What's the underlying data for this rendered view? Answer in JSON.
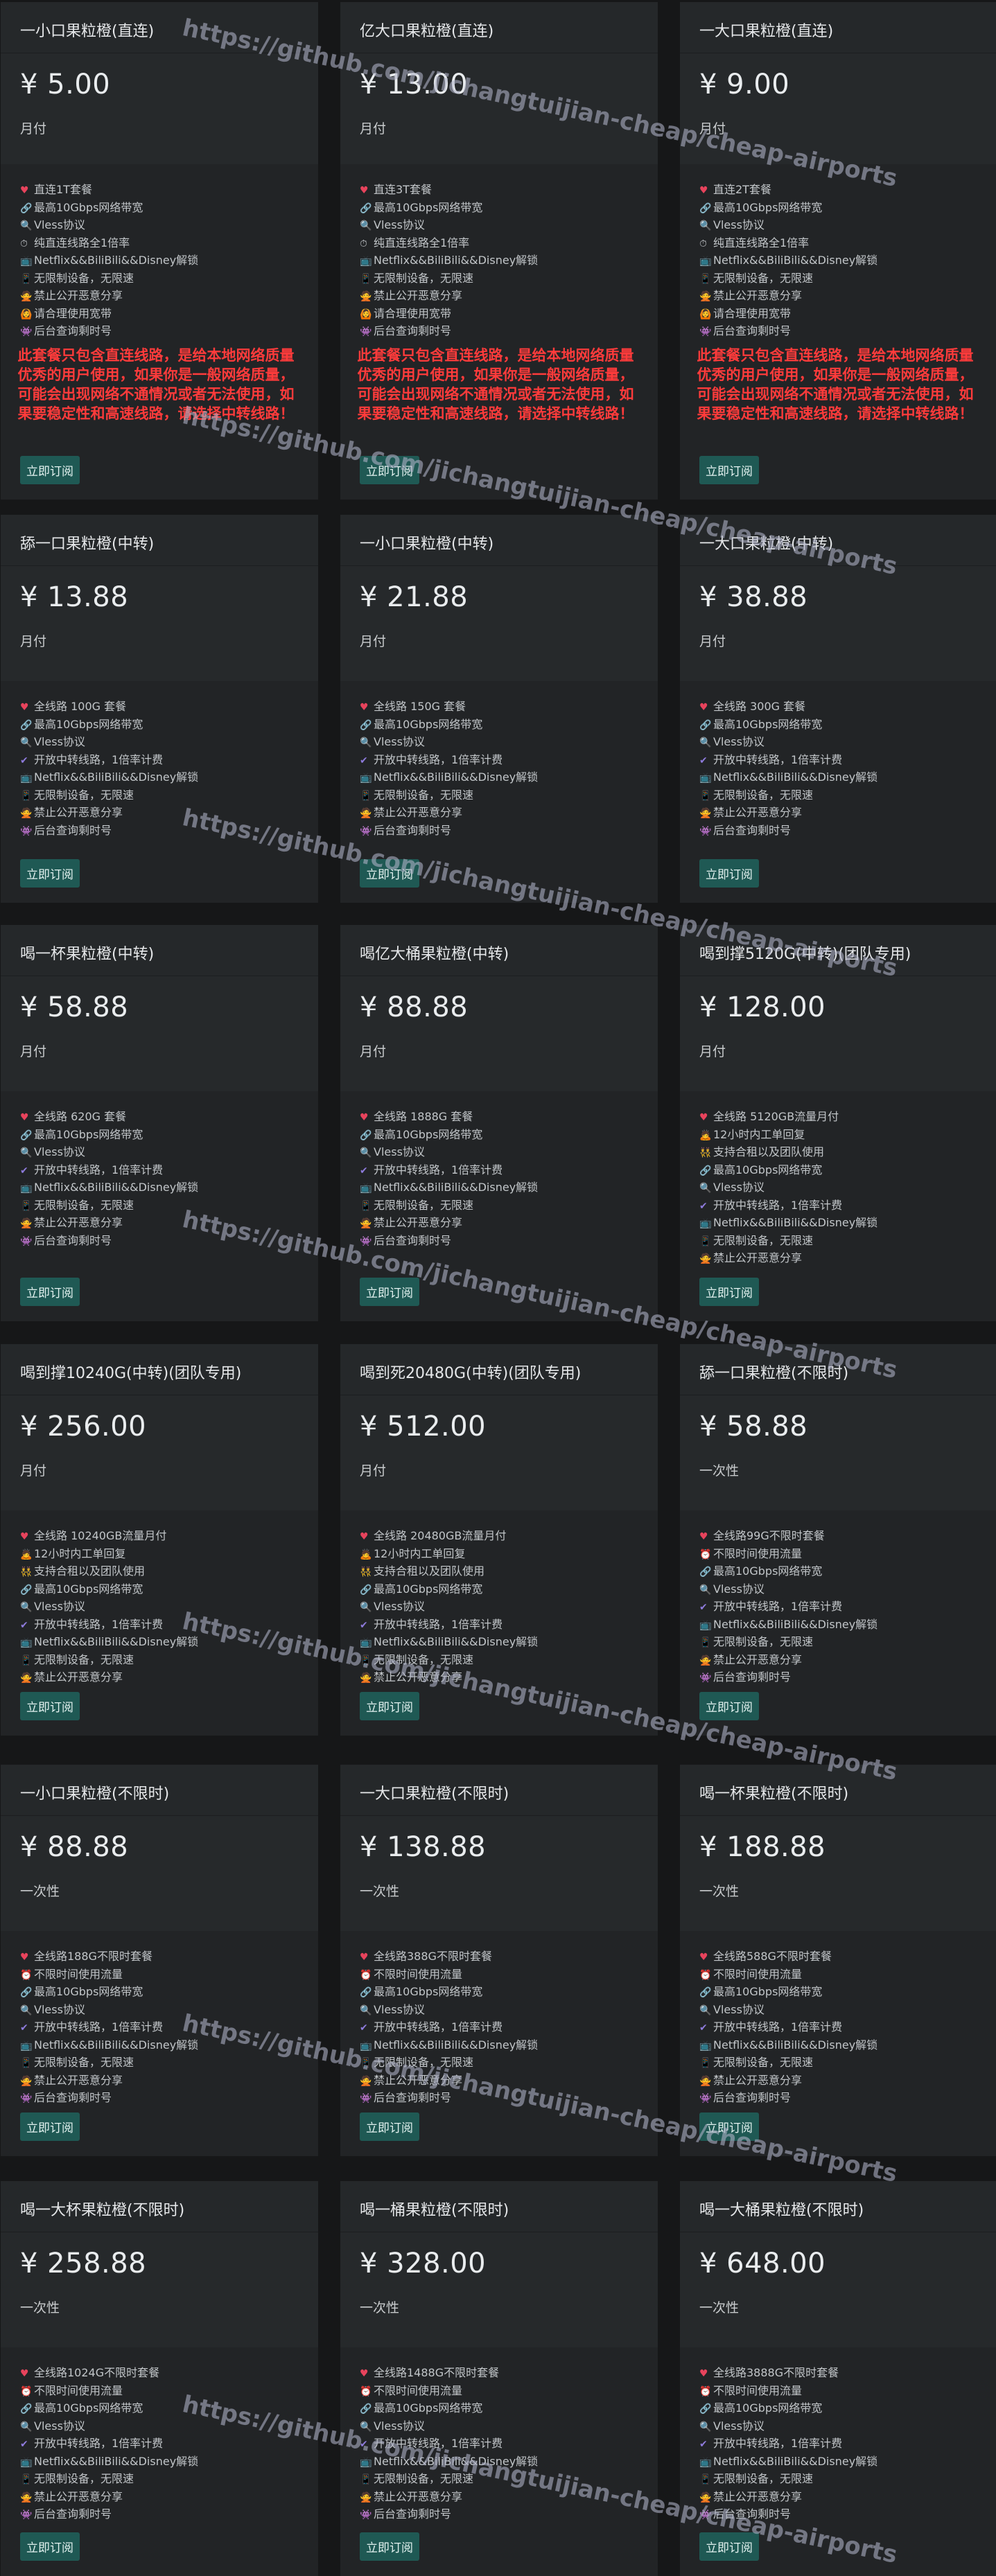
{
  "button_label": "立即订阅",
  "watermark": "https://github.com/jichangtuijian-cheap/cheap-airports",
  "warning": "此套餐只包含直连线路，是给本地网络质量优秀的用户使用，如果你是一般网络质量，可能会出现网络不通情况或者无法使用，如果要稳定性和高速线路，请选择中转线路！",
  "plans": [
    {
      "title": "一小口果粒橙(直连)",
      "price": "¥ 5.00",
      "period": "月付",
      "warning": true,
      "features": [
        [
          "heart",
          "直连1T套餐"
        ],
        [
          "link",
          "最高10Gbps网络带宽"
        ],
        [
          "search",
          "Vless协议"
        ],
        [
          "clock",
          "纯直连线路全1倍率"
        ],
        [
          "tv",
          "Netflix&&BiliBili&&Disney解锁"
        ],
        [
          "phone",
          "无限制设备，无限速"
        ],
        [
          "no",
          "禁止公开恶意分享"
        ],
        [
          "no2",
          "请合理使用宽带"
        ],
        [
          "admin",
          "后台查询剩时号"
        ]
      ]
    },
    {
      "title": "亿大口果粒橙(直连)",
      "price": "¥ 13.00",
      "period": "月付",
      "warning": true,
      "features": [
        [
          "heart",
          "直连3T套餐"
        ],
        [
          "link",
          "最高10Gbps网络带宽"
        ],
        [
          "search",
          "Vless协议"
        ],
        [
          "clock",
          "纯直连线路全1倍率"
        ],
        [
          "tv",
          "Netflix&&BiliBili&&Disney解锁"
        ],
        [
          "phone",
          "无限制设备，无限速"
        ],
        [
          "no",
          "禁止公开恶意分享"
        ],
        [
          "no2",
          "请合理使用宽带"
        ],
        [
          "admin",
          "后台查询剩时号"
        ]
      ]
    },
    {
      "title": "一大口果粒橙(直连)",
      "price": "¥ 9.00",
      "period": "月付",
      "warning": true,
      "features": [
        [
          "heart",
          "直连2T套餐"
        ],
        [
          "link",
          "最高10Gbps网络带宽"
        ],
        [
          "search",
          "Vless协议"
        ],
        [
          "clock",
          "纯直连线路全1倍率"
        ],
        [
          "tv",
          "Netflix&&BiliBili&&Disney解锁"
        ],
        [
          "phone",
          "无限制设备，无限速"
        ],
        [
          "no",
          "禁止公开恶意分享"
        ],
        [
          "no2",
          "请合理使用宽带"
        ],
        [
          "admin",
          "后台查询剩时号"
        ]
      ]
    },
    {
      "title": "舔一口果粒橙(中转)",
      "price": "¥ 13.88",
      "period": "月付",
      "warning": false,
      "features": [
        [
          "heart",
          "全线路 100G 套餐"
        ],
        [
          "link",
          "最高10Gbps网络带宽"
        ],
        [
          "search",
          "Vless协议"
        ],
        [
          "check",
          "开放中转线路，1倍率计费"
        ],
        [
          "tv",
          "Netflix&&BiliBili&&Disney解锁"
        ],
        [
          "phone",
          "无限制设备，无限速"
        ],
        [
          "no",
          "禁止公开恶意分享"
        ],
        [
          "admin",
          "后台查询剩时号"
        ]
      ]
    },
    {
      "title": "一小口果粒橙(中转)",
      "price": "¥ 21.88",
      "period": "月付",
      "warning": false,
      "features": [
        [
          "heart",
          "全线路 150G 套餐"
        ],
        [
          "link",
          "最高10Gbps网络带宽"
        ],
        [
          "search",
          "Vless协议"
        ],
        [
          "check",
          "开放中转线路，1倍率计费"
        ],
        [
          "tv",
          "Netflix&&BiliBili&&Disney解锁"
        ],
        [
          "phone",
          "无限制设备，无限速"
        ],
        [
          "no",
          "禁止公开恶意分享"
        ],
        [
          "admin",
          "后台查询剩时号"
        ]
      ]
    },
    {
      "title": "一大口果粒橙(中转)",
      "price": "¥ 38.88",
      "period": "月付",
      "warning": false,
      "features": [
        [
          "heart",
          "全线路 300G 套餐"
        ],
        [
          "link",
          "最高10Gbps网络带宽"
        ],
        [
          "search",
          "Vless协议"
        ],
        [
          "check",
          "开放中转线路，1倍率计费"
        ],
        [
          "tv",
          "Netflix&&BiliBili&&Disney解锁"
        ],
        [
          "phone",
          "无限制设备，无限速"
        ],
        [
          "no",
          "禁止公开恶意分享"
        ],
        [
          "admin",
          "后台查询剩时号"
        ]
      ]
    },
    {
      "title": "喝一杯果粒橙(中转)",
      "price": "¥ 58.88",
      "period": "月付",
      "warning": false,
      "features": [
        [
          "heart",
          "全线路 620G 套餐"
        ],
        [
          "link",
          "最高10Gbps网络带宽"
        ],
        [
          "search",
          "Vless协议"
        ],
        [
          "check",
          "开放中转线路，1倍率计费"
        ],
        [
          "tv",
          "Netflix&&BiliBili&&Disney解锁"
        ],
        [
          "phone",
          "无限制设备，无限速"
        ],
        [
          "no",
          "禁止公开恶意分享"
        ],
        [
          "admin",
          "后台查询剩时号"
        ]
      ]
    },
    {
      "title": "喝亿大桶果粒橙(中转)",
      "price": "¥ 88.88",
      "period": "月付",
      "warning": false,
      "features": [
        [
          "heart",
          "全线路 1888G 套餐"
        ],
        [
          "link",
          "最高10Gbps网络带宽"
        ],
        [
          "search",
          "Vless协议"
        ],
        [
          "check",
          "开放中转线路，1倍率计费"
        ],
        [
          "tv",
          "Netflix&&BiliBili&&Disney解锁"
        ],
        [
          "phone",
          "无限制设备，无限速"
        ],
        [
          "no",
          "禁止公开恶意分享"
        ],
        [
          "admin",
          "后台查询剩时号"
        ]
      ]
    },
    {
      "title": "喝到撑5120G(中转)(团队专用)",
      "price": "¥ 128.00",
      "period": "月付",
      "warning": false,
      "features": [
        [
          "heart",
          "全线路 5120GB流量月付"
        ],
        [
          "person",
          "12小时内工单回复"
        ],
        [
          "team",
          "支持合租以及团队使用"
        ],
        [
          "link",
          "最高10Gbps网络带宽"
        ],
        [
          "search",
          "Vless协议"
        ],
        [
          "check",
          "开放中转线路，1倍率计费"
        ],
        [
          "tv",
          "Netflix&&BiliBili&&Disney解锁"
        ],
        [
          "phone",
          "无限制设备，无限速"
        ],
        [
          "no",
          "禁止公开恶意分享"
        ]
      ]
    },
    {
      "title": "喝到撑10240G(中转)(团队专用)",
      "price": "¥ 256.00",
      "period": "月付",
      "warning": false,
      "features": [
        [
          "heart",
          "全线路 10240GB流量月付"
        ],
        [
          "person",
          "12小时内工单回复"
        ],
        [
          "team",
          "支持合租以及团队使用"
        ],
        [
          "link",
          "最高10Gbps网络带宽"
        ],
        [
          "search",
          "Vless协议"
        ],
        [
          "check",
          "开放中转线路，1倍率计费"
        ],
        [
          "tv",
          "Netflix&&BiliBili&&Disney解锁"
        ],
        [
          "phone",
          "无限制设备，无限速"
        ],
        [
          "no",
          "禁止公开恶意分享"
        ]
      ]
    },
    {
      "title": "喝到死20480G(中转)(团队专用)",
      "price": "¥ 512.00",
      "period": "月付",
      "warning": false,
      "features": [
        [
          "heart",
          "全线路 20480GB流量月付"
        ],
        [
          "person",
          "12小时内工单回复"
        ],
        [
          "team",
          "支持合租以及团队使用"
        ],
        [
          "link",
          "最高10Gbps网络带宽"
        ],
        [
          "search",
          "Vless协议"
        ],
        [
          "check",
          "开放中转线路，1倍率计费"
        ],
        [
          "tv",
          "Netflix&&BiliBili&&Disney解锁"
        ],
        [
          "phone",
          "无限制设备，无限速"
        ],
        [
          "no",
          "禁止公开恶意分享"
        ]
      ]
    },
    {
      "title": "舔一口果粒橙(不限时)",
      "price": "¥ 58.88",
      "period": "一次性",
      "warning": false,
      "features": [
        [
          "heart",
          "全线路99G不限时套餐"
        ],
        [
          "clock2",
          "不限时间使用流量"
        ],
        [
          "link",
          "最高10Gbps网络带宽"
        ],
        [
          "search",
          "Vless协议"
        ],
        [
          "check",
          "开放中转线路，1倍率计费"
        ],
        [
          "tv",
          "Netflix&&BiliBili&&Disney解锁"
        ],
        [
          "phone",
          "无限制设备，无限速"
        ],
        [
          "no",
          "禁止公开恶意分享"
        ],
        [
          "admin",
          "后台查询剩时号"
        ]
      ]
    },
    {
      "title": "一小口果粒橙(不限时)",
      "price": "¥ 88.88",
      "period": "一次性",
      "warning": false,
      "features": [
        [
          "heart",
          "全线路188G不限时套餐"
        ],
        [
          "clock2",
          "不限时间使用流量"
        ],
        [
          "link",
          "最高10Gbps网络带宽"
        ],
        [
          "search",
          "Vless协议"
        ],
        [
          "check",
          "开放中转线路，1倍率计费"
        ],
        [
          "tv",
          "Netflix&&BiliBili&&Disney解锁"
        ],
        [
          "phone",
          "无限制设备，无限速"
        ],
        [
          "no",
          "禁止公开恶意分享"
        ],
        [
          "admin",
          "后台查询剩时号"
        ]
      ]
    },
    {
      "title": "一大口果粒橙(不限时)",
      "price": "¥ 138.88",
      "period": "一次性",
      "warning": false,
      "features": [
        [
          "heart",
          "全线路388G不限时套餐"
        ],
        [
          "clock2",
          "不限时间使用流量"
        ],
        [
          "link",
          "最高10Gbps网络带宽"
        ],
        [
          "search",
          "Vless协议"
        ],
        [
          "check",
          "开放中转线路，1倍率计费"
        ],
        [
          "tv",
          "Netflix&&BiliBili&&Disney解锁"
        ],
        [
          "phone",
          "无限制设备，无限速"
        ],
        [
          "no",
          "禁止公开恶意分享"
        ],
        [
          "admin",
          "后台查询剩时号"
        ]
      ]
    },
    {
      "title": "喝一杯果粒橙(不限时)",
      "price": "¥ 188.88",
      "period": "一次性",
      "warning": false,
      "features": [
        [
          "heart",
          "全线路588G不限时套餐"
        ],
        [
          "clock2",
          "不限时间使用流量"
        ],
        [
          "link",
          "最高10Gbps网络带宽"
        ],
        [
          "search",
          "Vless协议"
        ],
        [
          "check",
          "开放中转线路，1倍率计费"
        ],
        [
          "tv",
          "Netflix&&BiliBili&&Disney解锁"
        ],
        [
          "phone",
          "无限制设备，无限速"
        ],
        [
          "no",
          "禁止公开恶意分享"
        ],
        [
          "admin",
          "后台查询剩时号"
        ]
      ]
    },
    {
      "title": "喝一大杯果粒橙(不限时)",
      "price": "¥ 258.88",
      "period": "一次性",
      "warning": false,
      "features": [
        [
          "heart",
          "全线路1024G不限时套餐"
        ],
        [
          "clock2",
          "不限时间使用流量"
        ],
        [
          "link",
          "最高10Gbps网络带宽"
        ],
        [
          "search",
          "Vless协议"
        ],
        [
          "check",
          "开放中转线路，1倍率计费"
        ],
        [
          "tv",
          "Netflix&&BiliBili&&Disney解锁"
        ],
        [
          "phone",
          "无限制设备，无限速"
        ],
        [
          "no",
          "禁止公开恶意分享"
        ],
        [
          "admin",
          "后台查询剩时号"
        ]
      ]
    },
    {
      "title": "喝一桶果粒橙(不限时)",
      "price": "¥ 328.00",
      "period": "一次性",
      "warning": false,
      "features": [
        [
          "heart",
          "全线路1488G不限时套餐"
        ],
        [
          "clock2",
          "不限时间使用流量"
        ],
        [
          "link",
          "最高10Gbps网络带宽"
        ],
        [
          "search",
          "Vless协议"
        ],
        [
          "check",
          "开放中转线路，1倍率计费"
        ],
        [
          "tv",
          "Netflix&&BiliBili&&Disney解锁"
        ],
        [
          "phone",
          "无限制设备，无限速"
        ],
        [
          "no",
          "禁止公开恶意分享"
        ],
        [
          "admin",
          "后台查询剩时号"
        ]
      ]
    },
    {
      "title": "喝一大桶果粒橙(不限时)",
      "price": "¥ 648.00",
      "period": "一次性",
      "warning": false,
      "features": [
        [
          "heart",
          "全线路3888G不限时套餐"
        ],
        [
          "clock2",
          "不限时间使用流量"
        ],
        [
          "link",
          "最高10Gbps网络带宽"
        ],
        [
          "search",
          "Vless协议"
        ],
        [
          "check",
          "开放中转线路，1倍率计费"
        ],
        [
          "tv",
          "Netflix&&BiliBili&&Disney解锁"
        ],
        [
          "phone",
          "无限制设备，无限速"
        ],
        [
          "no",
          "禁止公开恶意分享"
        ],
        [
          "admin",
          "后台查询剩时号"
        ]
      ]
    }
  ],
  "icons": {
    "heart": {
      "glyph": "♥",
      "color": "#e8435c",
      "name": "heart-icon"
    },
    "link": {
      "glyph": "🔗",
      "color": "#9aa7c7",
      "name": "link-icon"
    },
    "search": {
      "glyph": "🔍",
      "color": "#6aa8e8",
      "name": "search-icon"
    },
    "clock": {
      "glyph": "⏱",
      "color": "#c0c4c8",
      "name": "stopwatch-icon"
    },
    "clock2": {
      "glyph": "⏰",
      "color": "#d8d8d8",
      "name": "alarm-clock-icon"
    },
    "check": {
      "glyph": "✔",
      "color": "#8e7bdc",
      "name": "check-icon"
    },
    "tv": {
      "glyph": "📺",
      "color": "#9bb0c7",
      "name": "tv-icon"
    },
    "phone": {
      "glyph": "📱",
      "color": "#8f86c9",
      "name": "phone-icon"
    },
    "no": {
      "glyph": "🙅",
      "color": "#e2a27a",
      "name": "forbidden-gesture-icon"
    },
    "no2": {
      "glyph": "🙆",
      "color": "#e2a27a",
      "name": "ok-gesture-icon"
    },
    "admin": {
      "glyph": "👾",
      "color": "#b07ed8",
      "name": "alien-icon"
    },
    "person": {
      "glyph": "🙇",
      "color": "#e0b070",
      "name": "bowing-person-icon"
    },
    "team": {
      "glyph": "👯",
      "color": "#e0b070",
      "name": "team-icon"
    }
  }
}
